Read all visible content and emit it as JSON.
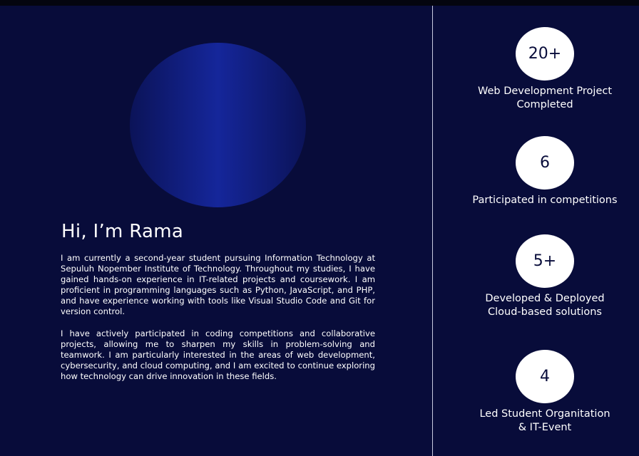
{
  "profile": {
    "greeting": "Hi, I’m Rama",
    "paragraph_1": "I am currently a second-year student pursuing Information Technology at Sepuluh Nopember Institute of Technology. Throughout my studies, I have gained hands-on experience in IT-related projects and coursework. I am proficient in programming languages such as Python, JavaScript, and PHP, and have experience working with tools like Visual Studio Code and Git for version control.",
    "paragraph_2": "I have actively participated in coding competitions and collaborative projects, allowing me to sharpen my skills in problem-solving and teamwork. I am particularly interested in the areas of web development, cybersecurity, and cloud computing, and I am excited to continue exploring how technology can drive innovation in these fields."
  },
  "stats": [
    {
      "value": "20+",
      "label_line_1": "Web Development Project",
      "label_line_2": "Completed"
    },
    {
      "value": "6",
      "label_line_1": "Participated in competitions",
      "label_line_2": ""
    },
    {
      "value": "5+",
      "label_line_1": "Developed & Deployed",
      "label_line_2": "Cloud-based solutions"
    },
    {
      "value": "4",
      "label_line_1": "Led Student Organitation",
      "label_line_2": "& IT-Event"
    }
  ],
  "colors": {
    "background": "#080c3a",
    "avatar_accent": "#15269a",
    "circle": "#ffffff"
  }
}
